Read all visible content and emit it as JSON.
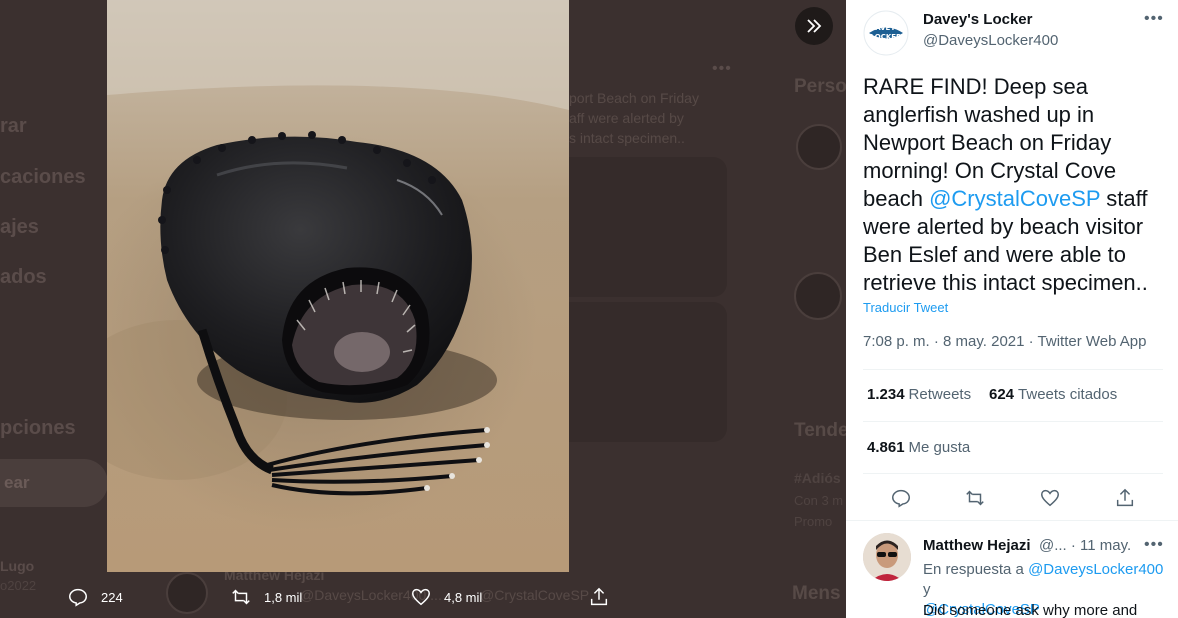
{
  "background": {
    "nav": [
      "rar",
      "caciones",
      "ajes",
      "ados",
      "pciones"
    ],
    "nav_button": "ear",
    "user_name": "Lugo",
    "user_handle": "o2022",
    "tweet_lines": [
      "port Beach on Friday",
      "aff were alerted by",
      "s intact specimen.."
    ],
    "side_headings": [
      "Perso",
      "Tende",
      "Mens"
    ],
    "trend": "#Adiós",
    "trend_meta": "Con 3 m",
    "trend_meta2": "Promo",
    "bg_reply_name": "Matthew Hejazi",
    "bg_reply_line": "@DaveysLocker400 ...",
    "bg_reply_line2": "@CrystalCoveSP"
  },
  "photo_actions": {
    "replies": "224",
    "retweets": "1,8 mil",
    "likes": "4,8 mil"
  },
  "tweet": {
    "author_name": "Davey's Locker",
    "author_handle": "@DaveysLocker400",
    "logo_line1": "DAVEY'S",
    "logo_line2": "LOCKER",
    "text_before": "RARE FIND! Deep sea anglerfish washed up in Newport Beach on Friday morning! On Crystal Cove beach ",
    "text_mention": "@CrystalCoveSP",
    "text_after": " staff were alerted by beach visitor Ben Eslef and were able to retrieve this intact specimen..",
    "translate_label": "Traducir Tweet",
    "meta": "7:08 p. m. · 8 may. 2021 · Twitter Web App",
    "retweets_count": "1.234",
    "retweets_label": "Retweets",
    "quotes_count": "624",
    "quotes_label": "Tweets citados",
    "likes_count": "4.861",
    "likes_label": "Me gusta"
  },
  "reply": {
    "name": "Matthew Hejazi",
    "handle_time": "@... · 11 may.",
    "in_reply_prefix": "En respuesta a ",
    "in_reply_mention1": "@DaveysLocker400",
    "in_reply_joiner": " y",
    "in_reply_mention2": "@CrystalCoveSP",
    "text": "Did someone ask why more and"
  },
  "colors": {
    "accent": "#1d9bf0",
    "overlay_bg": "#3b302f"
  }
}
